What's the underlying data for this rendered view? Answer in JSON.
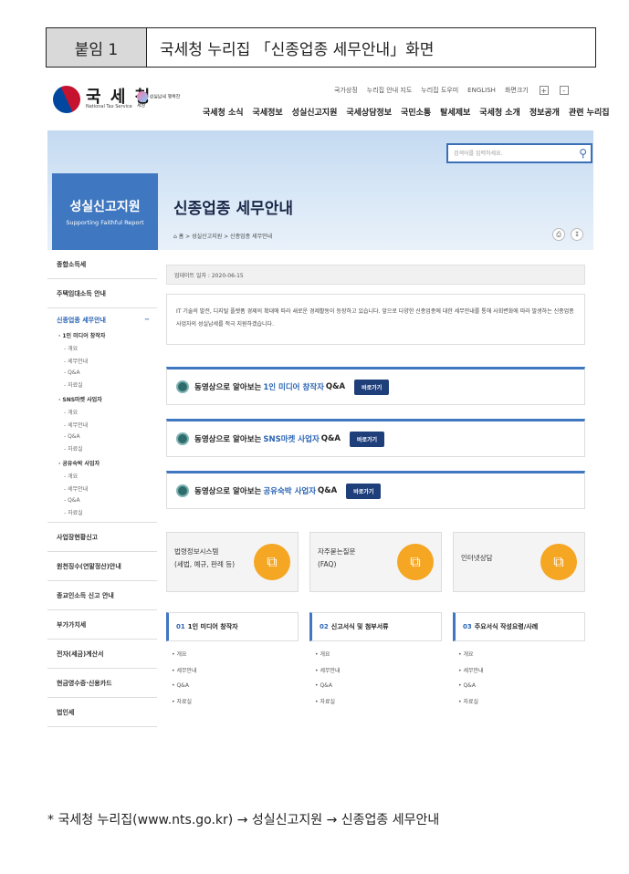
{
  "caption": {
    "label": "붙임 1",
    "title": "국세청 누리집 「신종업종 세무안내」화면"
  },
  "header": {
    "logo_kr": "국 세 청",
    "logo_en": "National Tax Service",
    "badge_text": "성실납세 행복한 세상",
    "util_links": [
      "국가상징",
      "누리집 안내 지도",
      "누리집 도우미",
      "ENGLISH",
      "화면크기"
    ],
    "zoom_in": "+",
    "zoom_out": "-",
    "nav": [
      "국세청 소식",
      "국세정보",
      "성실신고지원",
      "국세상담정보",
      "국민소통",
      "탈세제보",
      "국세청 소개",
      "정보공개",
      "관련 누리집"
    ]
  },
  "banner": {
    "search_placeholder": "검색어를 입력하세요.",
    "side_title": "성실신고지원",
    "side_sub": "Supporting Faithful Report",
    "page_title": "신종업종 세무안내",
    "breadcrumb": "홈 > 성실신고지원 > 신종업종 세무안내"
  },
  "sidebar": {
    "top_items": [
      "종합소득세",
      "주택임대소득 안내"
    ],
    "open_title": "신종업종 세무안내",
    "groups": [
      {
        "title": "· 1인 미디어 창작자",
        "leaves": [
          "- 개요",
          "- 세무안내",
          "- Q&A",
          "- 자료실"
        ]
      },
      {
        "title": "· SNS마켓 사업자",
        "leaves": [
          "- 개요",
          "- 세무안내",
          "- Q&A",
          "- 자료실"
        ]
      },
      {
        "title": "· 공유숙박 사업자",
        "leaves": [
          "- 개요",
          "- 세무안내",
          "- Q&A",
          "- 자료실"
        ]
      }
    ],
    "bottom_items": [
      "사업장현황신고",
      "원천징수(연말정산)안내",
      "종교인소득 신고 안내",
      "부가가치세",
      "전자(세금)계산서",
      "현금영수증·신용카드",
      "법인세"
    ]
  },
  "main": {
    "update": "업데이트 일자 : 2020-06-15",
    "intro": "IT 기술의 발전, 디지털 플랫폼 경제의 확대에 따라 새로운 경제활동이 등장하고 있습니다. 앞으로 다양한 신종업종에 대한 세무안내를 통해 사회변화에 따라 발생하는 신종업종 사업자의 성실납세를 적극 지원하겠습니다.",
    "videos": [
      {
        "pre": "동영상으로 알아보는",
        "hl": "1인 미디어 창작자",
        "post": "Q&A",
        "btn": "바로가기"
      },
      {
        "pre": "동영상으로 알아보는",
        "hl": "SNS마켓 사업자",
        "post": "Q&A",
        "btn": "바로가기"
      },
      {
        "pre": "동영상으로 알아보는",
        "hl": "공유숙박 사업자",
        "post": "Q&A",
        "btn": "바로가기"
      }
    ],
    "cards": [
      {
        "l1": "법령정보시스템",
        "l2": "(세법, 예규, 판례 등)"
      },
      {
        "l1": "자주묻는질문",
        "l2": "(FAQ)"
      },
      {
        "l1": "인터넷상담",
        "l2": ""
      }
    ],
    "columns": [
      {
        "num": "01",
        "title": "1인 미디어 창작자",
        "items": [
          "개요",
          "세무안내",
          "Q&A",
          "자료실"
        ]
      },
      {
        "num": "02",
        "title": "신고서식 및 첨부서류",
        "items": [
          "개요",
          "세무안내",
          "Q&A",
          "자료실"
        ]
      },
      {
        "num": "03",
        "title": "주요서식 작성요령/사례",
        "items": [
          "개요",
          "세무안내",
          "Q&A",
          "자료실"
        ]
      }
    ]
  },
  "footnote": "* 국세청 누리집(www.nts.go.kr) → 성실신고지원 → 신종업종 세무안내"
}
